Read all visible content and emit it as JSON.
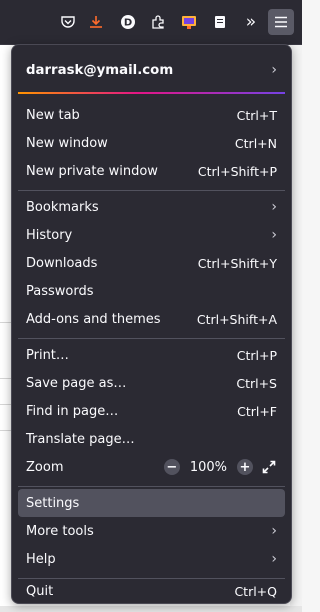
{
  "toolbar": {
    "icons": [
      "pocket-icon",
      "download-icon",
      "profile-icon",
      "extensions-icon",
      "screenshot-icon",
      "reader-icon",
      "overflow-icon",
      "hamburger-menu-icon"
    ],
    "profile_letter": "D",
    "overflow_glyph": "»"
  },
  "account": {
    "email": "darrask@ymail.com",
    "chevron": "›"
  },
  "menu": {
    "new_tab": {
      "label": "New tab",
      "shortcut": "Ctrl+T"
    },
    "new_window": {
      "label": "New window",
      "shortcut": "Ctrl+N"
    },
    "new_private_window": {
      "label": "New private window",
      "shortcut": "Ctrl+Shift+P"
    },
    "bookmarks": {
      "label": "Bookmarks",
      "chevron": "›"
    },
    "history": {
      "label": "History",
      "chevron": "›"
    },
    "downloads": {
      "label": "Downloads",
      "shortcut": "Ctrl+Shift+Y"
    },
    "passwords": {
      "label": "Passwords"
    },
    "addons": {
      "label": "Add-ons and themes",
      "shortcut": "Ctrl+Shift+A"
    },
    "print": {
      "label": "Print…",
      "shortcut": "Ctrl+P"
    },
    "save_page": {
      "label": "Save page as…",
      "shortcut": "Ctrl+S"
    },
    "find_in_page": {
      "label": "Find in page…",
      "shortcut": "Ctrl+F"
    },
    "translate_page": {
      "label": "Translate page…"
    },
    "zoom": {
      "label": "Zoom",
      "minus": "−",
      "value": "100%",
      "plus": "+"
    },
    "settings": {
      "label": "Settings"
    },
    "more_tools": {
      "label": "More tools",
      "chevron": "›"
    },
    "help": {
      "label": "Help",
      "chevron": "›"
    },
    "quit": {
      "label": "Quit",
      "shortcut": "Ctrl+Q"
    }
  },
  "colors": {
    "menu_bg": "#2b2a33",
    "hover_bg": "#52525e",
    "text": "#fbfbfe",
    "download_accent": "#ff6b2c",
    "account_gradient": [
      "#ff9400",
      "#e31587",
      "#7542e5"
    ]
  }
}
